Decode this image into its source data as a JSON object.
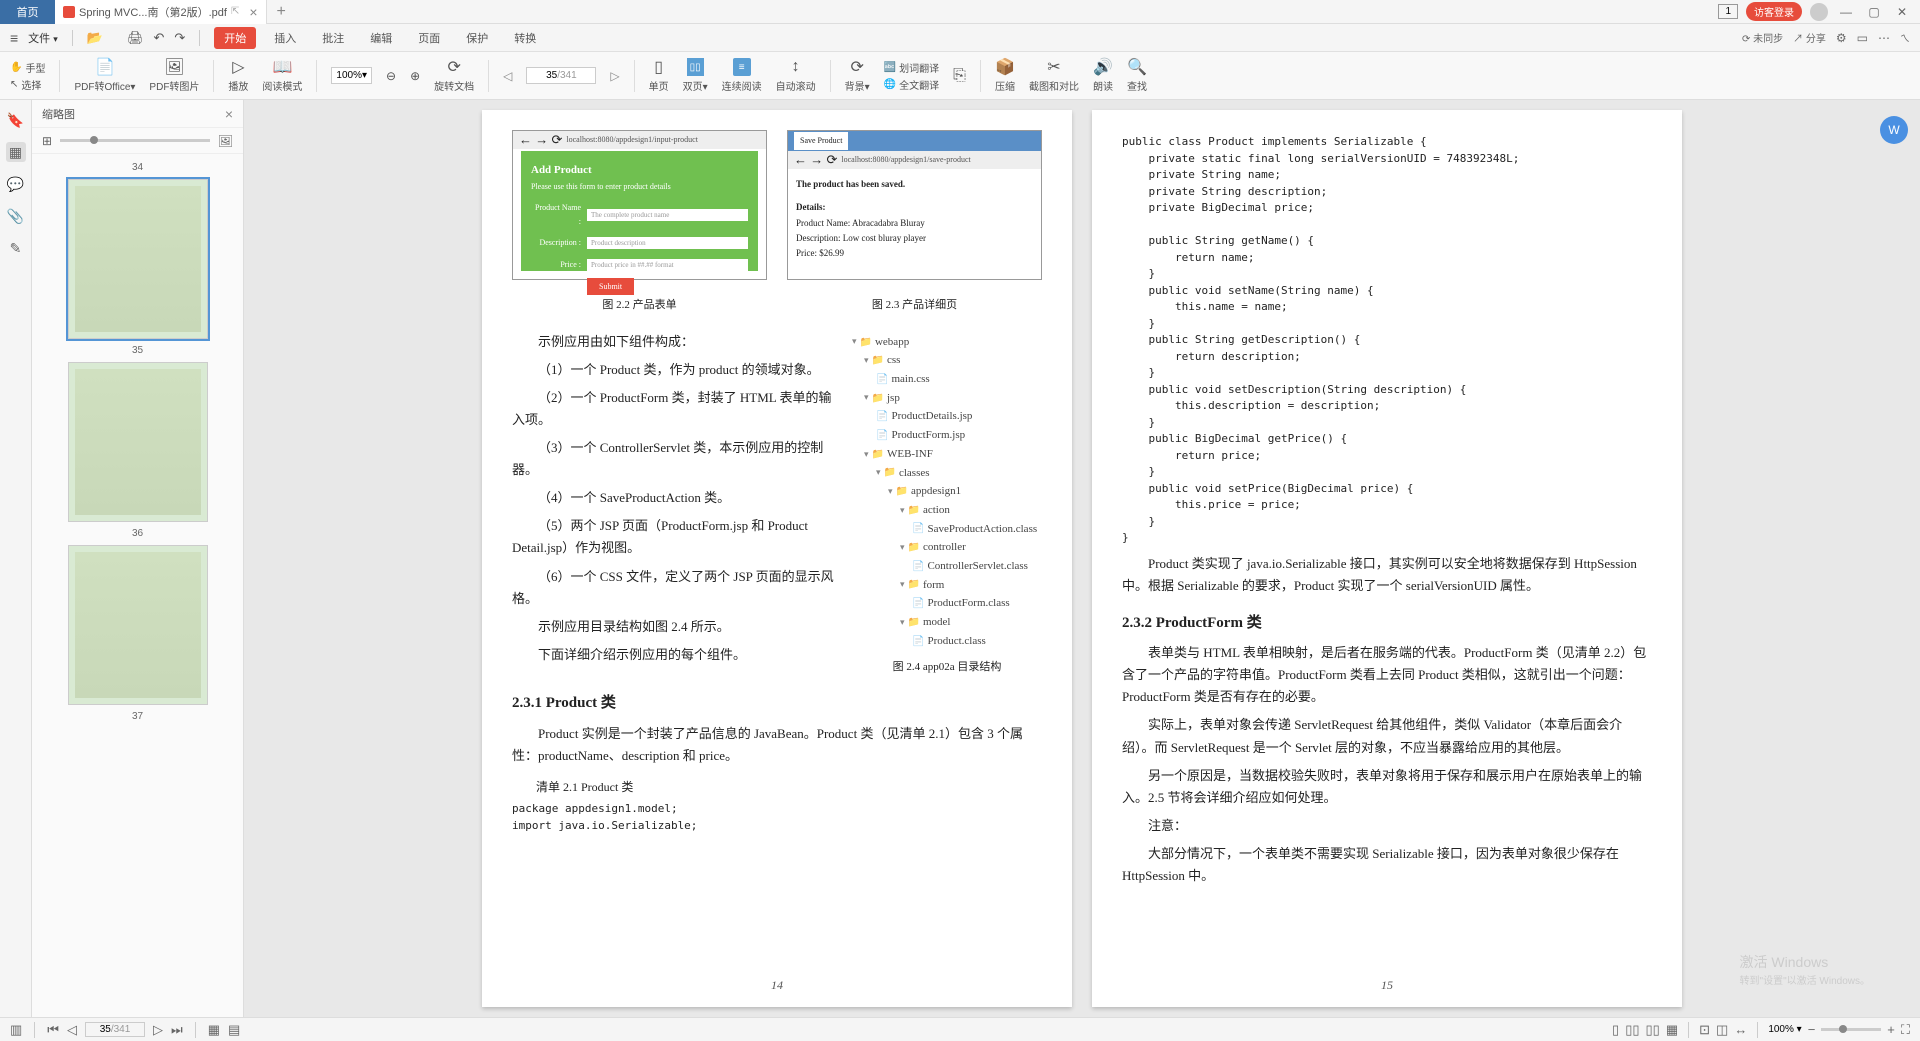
{
  "titlebar": {
    "home": "首页",
    "filename": "Spring MVC...南（第2版）.pdf",
    "badge": "1",
    "login": "访客登录"
  },
  "menubar": {
    "file": "文件",
    "items": [
      "开始",
      "插入",
      "批注",
      "编辑",
      "页面",
      "保护",
      "转换"
    ],
    "sync": "未同步",
    "share": "分享"
  },
  "toolbar": {
    "hand": "手型",
    "select": "选择",
    "pdf_office": "PDF转Office",
    "pdf_image": "PDF转图片",
    "play": "播放",
    "read_mode": "阅读模式",
    "zoom": "100%",
    "rotate": "旋转文档",
    "single": "单页",
    "double": "双页",
    "continuous": "连续阅读",
    "autoscroll": "自动滚动",
    "page_current": "35",
    "page_total": "/341",
    "background": "背景",
    "word_trans": "划词翻译",
    "full_trans": "全文翻译",
    "compress": "压缩",
    "screenshot": "截图和对比",
    "read_aloud": "朗读",
    "find": "查找"
  },
  "thumbs": {
    "title": "缩略图",
    "pages": [
      "34",
      "35",
      "36",
      "37"
    ]
  },
  "page_left": {
    "form_title": "Add Product",
    "form_sub": "Please use this form to enter product details",
    "url1": "localhost:8080/appdesign1/input-product",
    "label_name": "Product Name :",
    "label_desc": "Description :",
    "label_price": "Price :",
    "ph_name": "The complete product name",
    "ph_desc": "Product description",
    "ph_price": "Product price in ##.## format",
    "submit": "Submit",
    "tab2": "Save Product",
    "url2": "localhost:8080/appdesign1/save-product",
    "saved_msg": "The product has been saved.",
    "details": "Details:",
    "detail_name": "Product Name: Abracadabra Bluray",
    "detail_desc": "Description: Low cost bluray player",
    "detail_price": "Price: $26.99",
    "fig22": "图 2.2    产品表单",
    "fig23": "图 2.3    产品详细页",
    "para1": "示例应用由如下组件构成：",
    "item1": "（1）一个 Product 类，作为 product 的领域对象。",
    "item2": "（2）一个 ProductForm 类，封装了 HTML 表单的输入项。",
    "item3": "（3）一个 ControllerServlet 类，本示例应用的控制器。",
    "item4": "（4）一个 SaveProductAction 类。",
    "item5": "（5）两个 JSP 页面（ProductForm.jsp 和 Product Detail.jsp）作为视图。",
    "item6": "（6）一个 CSS 文件，定义了两个 JSP 页面的显示风格。",
    "para2": "示例应用目录结构如图 2.4 所示。",
    "para3": "下面详细介绍示例应用的每个组件。",
    "fig24": "图 2.4    app02a 目录结构",
    "sec231": "2.3.1    Product 类",
    "para231": "Product 实例是一个封装了产品信息的 JavaBean。Product 类（见清单 2.1）包含 3 个属性：productName、description 和 price。",
    "listing21": "清单 2.1    Product 类",
    "code21": "package appdesign1.model;\nimport java.io.Serializable;",
    "tree": {
      "webapp": "webapp",
      "css": "css",
      "maincss": "main.css",
      "jsp": "jsp",
      "pd": "ProductDetails.jsp",
      "pf": "ProductForm.jsp",
      "webinf": "WEB-INF",
      "classes": "classes",
      "appdesign1": "appdesign1",
      "action": "action",
      "spa": "SaveProductAction.class",
      "controller": "controller",
      "cs": "ControllerServlet.class",
      "form": "form",
      "pfc": "ProductForm.class",
      "model": "model",
      "pc": "Product.class"
    },
    "page_num": "14"
  },
  "page_right": {
    "code": "public class Product implements Serializable {\n    private static final long serialVersionUID = 748392348L;\n    private String name;\n    private String description;\n    private BigDecimal price;\n\n    public String getName() {\n        return name;\n    }\n    public void setName(String name) {\n        this.name = name;\n    }\n    public String getDescription() {\n        return description;\n    }\n    public void setDescription(String description) {\n        this.description = description;\n    }\n    public BigDecimal getPrice() {\n        return price;\n    }\n    public void setPrice(BigDecimal price) {\n        this.price = price;\n    }\n}",
    "para1": "Product 类实现了 java.io.Serializable 接口，其实例可以安全地将数据保存到 HttpSession 中。根据 Serializable 的要求，Product 实现了一个 serialVersionUID 属性。",
    "sec232": "2.3.2    ProductForm 类",
    "para2": "表单类与 HTML 表单相映射，是后者在服务端的代表。ProductForm 类（见清单 2.2）包含了一个产品的字符串值。ProductForm 类看上去同 Product 类相似，这就引出一个问题：ProductForm 类是否有存在的必要。",
    "para3": "实际上，表单对象会传递 ServletRequest 给其他组件，类似 Validator（本章后面会介绍）。而 ServletRequest 是一个 Servlet 层的对象，不应当暴露给应用的其他层。",
    "para4": "另一个原因是，当数据校验失败时，表单对象将用于保存和展示用户在原始表单上的输入。2.5 节将会详细介绍应如何处理。",
    "note": "注意：",
    "para5": "大部分情况下，一个表单类不需要实现 Serializable 接口，因为表单对象很少保存在 HttpSession 中。",
    "page_num": "15"
  },
  "watermark": {
    "line1": "激活 Windows",
    "line2": "转到\"设置\"以激活 Windows。"
  },
  "statusbar": {
    "page": "35",
    "total": "/341",
    "zoom": "100%"
  }
}
